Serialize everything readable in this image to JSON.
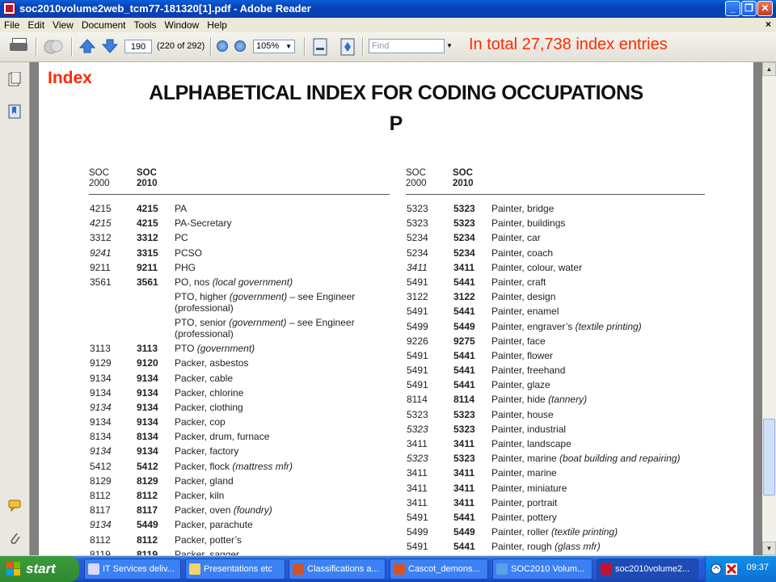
{
  "window": {
    "title": "soc2010volume2web_tcm77-181320[1].pdf - Adobe Reader",
    "min_glyph": "_",
    "max_glyph": "❐",
    "close_glyph": "✕"
  },
  "menu": [
    "File",
    "Edit",
    "View",
    "Document",
    "Tools",
    "Window",
    "Help"
  ],
  "menu_close_glyph": "×",
  "toolbar": {
    "page_number": "190",
    "page_count": "(220 of 292)",
    "zoom": "105%",
    "find_placeholder": "Find"
  },
  "annotations": {
    "top": "In total 27,738 index entries",
    "left": "Index"
  },
  "document": {
    "title": "ALPHABETICAL INDEX FOR CODING OCCUPATIONS",
    "letter": "P",
    "header": {
      "c1_a": "SOC",
      "c1_b": "2000",
      "c2_a": "SOC",
      "c2_b": "2010"
    },
    "left_entries": [
      {
        "soc2000": "4215",
        "soc2010": "4215",
        "title": "PA",
        "qual": "",
        "tail": "",
        "it": false
      },
      {
        "soc2000": "4215",
        "soc2010": "4215",
        "title": "PA-Secretary",
        "qual": "",
        "tail": "",
        "it": true
      },
      {
        "soc2000": "3312",
        "soc2010": "3312",
        "title": "PC",
        "qual": "",
        "tail": "",
        "it": false
      },
      {
        "soc2000": "9241",
        "soc2010": "3315",
        "title": "PCSO",
        "qual": "",
        "tail": "",
        "it": true
      },
      {
        "soc2000": "9211",
        "soc2010": "9211",
        "title": "PHG",
        "qual": "",
        "tail": "",
        "it": false
      },
      {
        "soc2000": "3561",
        "soc2010": "3561",
        "title": "PO, nos ",
        "qual": "(local government)",
        "tail": "",
        "it": false
      },
      {
        "soc2000": "",
        "soc2010": "",
        "title": "PTO, higher ",
        "qual": "(government)",
        "tail": " – see Engineer\n(professional)",
        "it": false,
        "tall": true
      },
      {
        "soc2000": "",
        "soc2010": "",
        "title": "PTO, senior ",
        "qual": "(government)",
        "tail": " – see Engineer\n(professional)",
        "it": false,
        "tall": true
      },
      {
        "soc2000": "3113",
        "soc2010": "3113",
        "title": "PTO ",
        "qual": "(government)",
        "tail": "",
        "it": false
      },
      {
        "soc2000": "9129",
        "soc2010": "9120",
        "title": "Packer, asbestos",
        "qual": "",
        "tail": "",
        "it": false
      },
      {
        "soc2000": "9134",
        "soc2010": "9134",
        "title": "Packer, cable",
        "qual": "",
        "tail": "",
        "it": false
      },
      {
        "soc2000": "9134",
        "soc2010": "9134",
        "title": "Packer, chlorine",
        "qual": "",
        "tail": "",
        "it": false
      },
      {
        "soc2000": "9134",
        "soc2010": "9134",
        "title": "Packer, clothing",
        "qual": "",
        "tail": "",
        "it": true
      },
      {
        "soc2000": "9134",
        "soc2010": "9134",
        "title": "Packer, cop",
        "qual": "",
        "tail": "",
        "it": false
      },
      {
        "soc2000": "8134",
        "soc2010": "8134",
        "title": "Packer, drum, furnace",
        "qual": "",
        "tail": "",
        "it": false
      },
      {
        "soc2000": "9134",
        "soc2010": "9134",
        "title": "Packer, factory",
        "qual": "",
        "tail": "",
        "it": true
      },
      {
        "soc2000": "5412",
        "soc2010": "5412",
        "title": "Packer, flock ",
        "qual": "(mattress mfr)",
        "tail": "",
        "it": false
      },
      {
        "soc2000": "8129",
        "soc2010": "8129",
        "title": "Packer, gland",
        "qual": "",
        "tail": "",
        "it": false
      },
      {
        "soc2000": "8112",
        "soc2010": "8112",
        "title": "Packer, kiln",
        "qual": "",
        "tail": "",
        "it": false
      },
      {
        "soc2000": "8117",
        "soc2010": "8117",
        "title": "Packer, oven ",
        "qual": "(foundry)",
        "tail": "",
        "it": false
      },
      {
        "soc2000": "9134",
        "soc2010": "5449",
        "title": "Packer, parachute",
        "qual": "",
        "tail": "",
        "it": true
      },
      {
        "soc2000": "8112",
        "soc2010": "8112",
        "title": "Packer, potter’s",
        "qual": "",
        "tail": "",
        "it": false
      },
      {
        "soc2000": "8119",
        "soc2010": "8119",
        "title": "Packer, sagger",
        "qual": "",
        "tail": "",
        "it": false
      }
    ],
    "right_entries": [
      {
        "soc2000": "5323",
        "soc2010": "5323",
        "title": "Painter, bridge",
        "qual": "",
        "it": false
      },
      {
        "soc2000": "5323",
        "soc2010": "5323",
        "title": "Painter, buildings",
        "qual": "",
        "it": false
      },
      {
        "soc2000": "5234",
        "soc2010": "5234",
        "title": "Painter, car",
        "qual": "",
        "it": false
      },
      {
        "soc2000": "5234",
        "soc2010": "5234",
        "title": "Painter, coach",
        "qual": "",
        "it": false
      },
      {
        "soc2000": "3411",
        "soc2010": "3411",
        "title": "Painter, colour, water",
        "qual": "",
        "it": true
      },
      {
        "soc2000": "5491",
        "soc2010": "5441",
        "title": "Painter, craft",
        "qual": "",
        "it": false
      },
      {
        "soc2000": "3122",
        "soc2010": "3122",
        "title": "Painter, design",
        "qual": "",
        "it": false
      },
      {
        "soc2000": "5491",
        "soc2010": "5441",
        "title": "Painter, enamel",
        "qual": "",
        "it": false
      },
      {
        "soc2000": "5499",
        "soc2010": "5449",
        "title": "Painter, engraver’s ",
        "qual": "(textile printing)",
        "it": false
      },
      {
        "soc2000": "9226",
        "soc2010": "9275",
        "title": "Painter, face",
        "qual": "",
        "it": false
      },
      {
        "soc2000": "5491",
        "soc2010": "5441",
        "title": "Painter, flower",
        "qual": "",
        "it": false
      },
      {
        "soc2000": "5491",
        "soc2010": "5441",
        "title": "Painter, freehand",
        "qual": "",
        "it": false
      },
      {
        "soc2000": "5491",
        "soc2010": "5441",
        "title": "Painter, glaze",
        "qual": "",
        "it": false
      },
      {
        "soc2000": "8114",
        "soc2010": "8114",
        "title": "Painter, hide ",
        "qual": "(tannery)",
        "it": false
      },
      {
        "soc2000": "5323",
        "soc2010": "5323",
        "title": "Painter, house",
        "qual": "",
        "it": false
      },
      {
        "soc2000": "5323",
        "soc2010": "5323",
        "title": "Painter, industrial",
        "qual": "",
        "it": true
      },
      {
        "soc2000": "3411",
        "soc2010": "3411",
        "title": "Painter, landscape",
        "qual": "",
        "it": false
      },
      {
        "soc2000": "5323",
        "soc2010": "5323",
        "title": "Painter, marine ",
        "qual": "(boat building and repairing)",
        "it": true
      },
      {
        "soc2000": "3411",
        "soc2010": "3411",
        "title": "Painter, marine",
        "qual": "",
        "it": false
      },
      {
        "soc2000": "3411",
        "soc2010": "3411",
        "title": "Painter, miniature",
        "qual": "",
        "it": false
      },
      {
        "soc2000": "3411",
        "soc2010": "3411",
        "title": "Painter, portrait",
        "qual": "",
        "it": false
      },
      {
        "soc2000": "5491",
        "soc2010": "5441",
        "title": "Painter, pottery",
        "qual": "",
        "it": false
      },
      {
        "soc2000": "5499",
        "soc2010": "5449",
        "title": "Painter, roller ",
        "qual": "(textile printing)",
        "it": false
      },
      {
        "soc2000": "5491",
        "soc2010": "5441",
        "title": "Painter, rough ",
        "qual": "(glass mfr)",
        "it": false
      }
    ]
  },
  "taskbar": {
    "start_label": "start",
    "tasks": [
      {
        "label": "IT Services deliv...",
        "icon_color": "#d9d9ff"
      },
      {
        "label": "Presentations etc",
        "icon_color": "#f3d36b"
      },
      {
        "label": "Classifications a...",
        "icon_color": "#d0542b"
      },
      {
        "label": "Cascot_demons...",
        "icon_color": "#d0542b"
      },
      {
        "label": "SOC2010 Volum...",
        "icon_color": "#5aa0e8"
      },
      {
        "label": "soc2010volume2...",
        "icon_color": "#c8102e"
      }
    ],
    "clock": "09:37"
  },
  "colors": {
    "annotation": "#ff2a00",
    "titlebar": "#0a5fd8"
  }
}
